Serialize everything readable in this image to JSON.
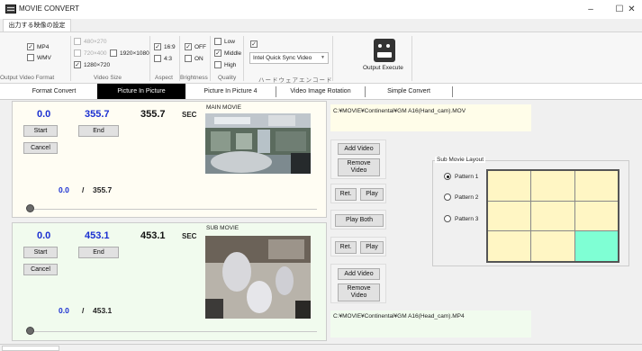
{
  "window": {
    "title": "MOVIE CONVERT",
    "controls": {
      "minimize": "–",
      "maximize": "☐",
      "close": "✕"
    }
  },
  "ribbon": {
    "tab_label": "出力する映像の設定",
    "output_format": {
      "label": "Output Video Format",
      "options": [
        {
          "label": "MP4",
          "checked": true
        },
        {
          "label": "WMV",
          "checked": false
        }
      ]
    },
    "video_size": {
      "label": "Video Size",
      "options": [
        {
          "label": "480×270",
          "checked": false,
          "enabled": false
        },
        {
          "label": "720×400",
          "checked": false,
          "enabled": false
        },
        {
          "label": "1920×1080",
          "checked": false,
          "enabled": true
        },
        {
          "label": "1280×720",
          "checked": true,
          "enabled": true
        }
      ]
    },
    "aspect": {
      "label": "Aspect",
      "options": [
        {
          "label": "16:9",
          "checked": true
        },
        {
          "label": "4:3",
          "checked": false
        }
      ]
    },
    "brightness": {
      "label": "Brightness",
      "options": [
        {
          "label": "OFF",
          "checked": true
        },
        {
          "label": "ON",
          "checked": false
        }
      ]
    },
    "quality": {
      "label": "Quality",
      "options": [
        {
          "label": "Low",
          "checked": false
        },
        {
          "label": "Middle",
          "checked": true
        },
        {
          "label": "High",
          "checked": false
        }
      ]
    },
    "hw_encode": {
      "label": "ハードウェアエンコード",
      "checked": true,
      "encoder": "Intel Quick Sync Video"
    },
    "output_execute": {
      "label": "Output Execute",
      "icon": "projector-icon"
    }
  },
  "mode_tabs": [
    "Format Convert",
    "Picture In Picture",
    "Picture In Picture 4",
    "Video Image Rotation",
    "Simple Convert"
  ],
  "mode_tab_active": 1,
  "main": {
    "start": "0.0",
    "end": "355.7",
    "duration": "355.7",
    "sec": "SEC",
    "start_btn": "Start",
    "end_btn": "End",
    "cancel_btn": "Cancel",
    "position": "0.0",
    "slash": "/",
    "total": "355.7",
    "movie_label": "MAIN MOVIE",
    "path": "C:¥MOVIE¥Continental¥GM A16(Hand_cam).MOV",
    "add_video": "Add Video",
    "remove_video": "Remove Video",
    "ret": "Ret.",
    "play": "Play"
  },
  "play_both": "Play Both",
  "sub": {
    "start": "0.0",
    "end": "453.1",
    "duration": "453.1",
    "sec": "SEC",
    "start_btn": "Start",
    "end_btn": "End",
    "cancel_btn": "Cancel",
    "position": "0.0",
    "slash": "/",
    "total": "453.1",
    "movie_label": "SUB MOVIE",
    "path": "C:¥MOVIE¥Continental¥GM A16(Head_cam).MP4",
    "add_video": "Add Video",
    "remove_video": "Remove Video",
    "ret": "Ret.",
    "play": "Play"
  },
  "layout": {
    "title": "Sub Movie Layout",
    "patterns": [
      "Pattern 1",
      "Pattern 2",
      "Pattern 3"
    ],
    "selected": 0,
    "highlight_color": "#7fffd4"
  }
}
